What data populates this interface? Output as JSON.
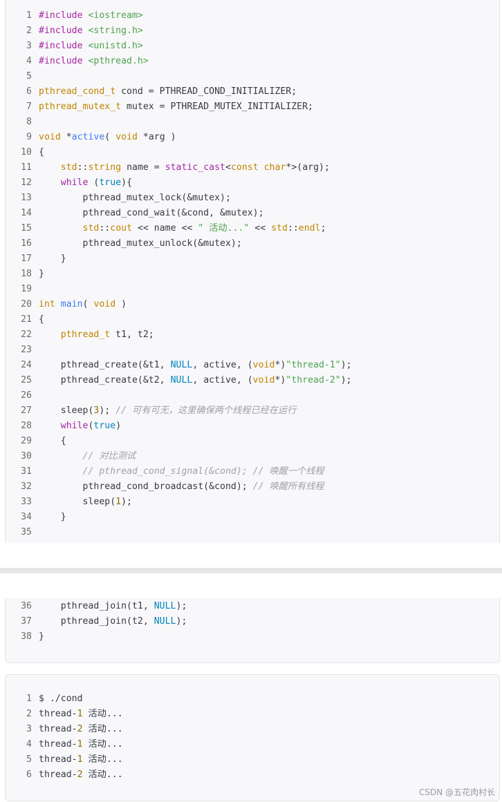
{
  "code_block_1": {
    "lines": [
      {
        "n": "1",
        "t": "#include <iostream>"
      },
      {
        "n": "2",
        "t": "#include <string.h>"
      },
      {
        "n": "3",
        "t": "#include <unistd.h>"
      },
      {
        "n": "4",
        "t": "#include <pthread.h>"
      },
      {
        "n": "5",
        "t": ""
      },
      {
        "n": "6",
        "t": "pthread_cond_t cond = PTHREAD_COND_INITIALIZER;"
      },
      {
        "n": "7",
        "t": "pthread_mutex_t mutex = PTHREAD_MUTEX_INITIALIZER;"
      },
      {
        "n": "8",
        "t": ""
      },
      {
        "n": "9",
        "t": "void *active( void *arg )"
      },
      {
        "n": "10",
        "t": "{"
      },
      {
        "n": "11",
        "t": "    std::string name = static_cast<const char*>(arg);"
      },
      {
        "n": "12",
        "t": "    while (true){"
      },
      {
        "n": "13",
        "t": "        pthread_mutex_lock(&mutex);"
      },
      {
        "n": "14",
        "t": "        pthread_cond_wait(&cond, &mutex);"
      },
      {
        "n": "15",
        "t": "        std::cout << name << \" 活动...\" << std::endl;"
      },
      {
        "n": "16",
        "t": "        pthread_mutex_unlock(&mutex);"
      },
      {
        "n": "17",
        "t": "    }"
      },
      {
        "n": "18",
        "t": "}"
      },
      {
        "n": "19",
        "t": ""
      },
      {
        "n": "20",
        "t": "int main( void )"
      },
      {
        "n": "21",
        "t": "{"
      },
      {
        "n": "22",
        "t": "    pthread_t t1, t2;"
      },
      {
        "n": "23",
        "t": ""
      },
      {
        "n": "24",
        "t": "    pthread_create(&t1, NULL, active, (void*)\"thread-1\");"
      },
      {
        "n": "25",
        "t": "    pthread_create(&t2, NULL, active, (void*)\"thread-2\");"
      },
      {
        "n": "26",
        "t": ""
      },
      {
        "n": "27",
        "t": "    sleep(3); // 可有可无，这里确保两个线程已经在运行"
      },
      {
        "n": "28",
        "t": "    while(true)"
      },
      {
        "n": "29",
        "t": "    {"
      },
      {
        "n": "30",
        "t": "        // 对比测试"
      },
      {
        "n": "31",
        "t": "        // pthread_cond_signal(&cond); // 唤醒一个线程"
      },
      {
        "n": "32",
        "t": "        pthread_cond_broadcast(&cond); // 唤醒所有线程"
      },
      {
        "n": "33",
        "t": "        sleep(1);"
      },
      {
        "n": "34",
        "t": "    }"
      },
      {
        "n": "35",
        "t": ""
      }
    ]
  },
  "code_block_2": {
    "lines": [
      {
        "n": "36",
        "t": "    pthread_join(t1, NULL);"
      },
      {
        "n": "37",
        "t": "    pthread_join(t2, NULL);"
      },
      {
        "n": "38",
        "t": "}"
      }
    ]
  },
  "output_block": {
    "lines": [
      {
        "n": "1",
        "t": "$ ./cond"
      },
      {
        "n": "2",
        "t": "thread-1 活动..."
      },
      {
        "n": "3",
        "t": "thread-2 活动..."
      },
      {
        "n": "4",
        "t": "thread-1 活动..."
      },
      {
        "n": "5",
        "t": "thread-1 活动..."
      },
      {
        "n": "6",
        "t": "thread-2 活动..."
      }
    ]
  },
  "watermark": "CSDN @五花肉村长",
  "colors": {
    "keyword": "#a626a4",
    "type": "#c18401",
    "function": "#4078f2",
    "string": "#50a14f",
    "number": "#986801",
    "literal": "#0184bc",
    "comment": "#a0a1a7"
  }
}
